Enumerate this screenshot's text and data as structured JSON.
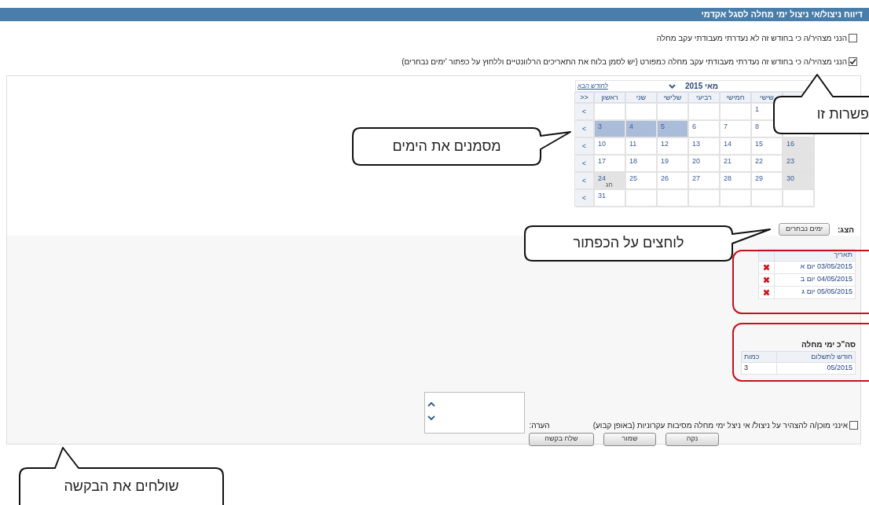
{
  "title": "דיווח ניצול/אי ניצול ימי מחלה לסגל אקדמי",
  "declarations": [
    {
      "label": "הנני מצהיר/ה כי בחודש זה לא נעדרתי מעבודתי עקב מחלה",
      "checked": false
    },
    {
      "label": "הנני מצהיר/ה כי בחודש זה נעדרתי מעבודתי עקב מחלה כמפורט (יש לסמן בלוח את התאריכים הרלוונטיים וללחוץ על כפתור 'ימים נבחרים)",
      "checked": true
    }
  ],
  "calendar": {
    "next_link": "לחודש הבא",
    "month": "מאי 2015",
    "week_header": ">>",
    "weekdays": [
      "שישי",
      "חמישי",
      "רביעי",
      "שלישי",
      "שני",
      "ראשון"
    ],
    "weeks": [
      {
        "arrow": ">",
        "days": [
          {
            "day": "1",
            "selected": false,
            "shaded": false
          }
        ]
      },
      {
        "arrow": ">",
        "days": [
          {
            "day": "8",
            "selected": false,
            "shaded": false
          },
          {
            "day": "7",
            "selected": false,
            "shaded": false
          },
          {
            "day": "6",
            "selected": false,
            "shaded": false
          },
          {
            "day": "5",
            "selected": true
          },
          {
            "day": "4",
            "selected": true
          },
          {
            "day": "3",
            "selected": true
          }
        ]
      },
      {
        "arrow": ">",
        "days": [
          {
            "day": "16",
            "selected": false,
            "shaded": true
          },
          {
            "day": "15",
            "selected": false,
            "shaded": false
          },
          {
            "day": "14",
            "selected": false,
            "shaded": false
          },
          {
            "day": "13",
            "selected": false,
            "shaded": false
          },
          {
            "day": "12",
            "selected": false,
            "shaded": false
          },
          {
            "day": "11",
            "selected": false,
            "shaded": false
          },
          {
            "day": "10",
            "selected": false,
            "shaded": false
          }
        ]
      },
      {
        "arrow": ">",
        "days": [
          {
            "day": "23",
            "selected": false,
            "shaded": true
          },
          {
            "day": "22",
            "selected": false,
            "shaded": false
          },
          {
            "day": "21",
            "selected": false,
            "shaded": false
          },
          {
            "day": "20",
            "selected": false,
            "shaded": false
          },
          {
            "day": "19",
            "selected": false,
            "shaded": false
          },
          {
            "day": "18",
            "selected": false,
            "shaded": false
          },
          {
            "day": "17",
            "selected": false,
            "shaded": false
          }
        ]
      },
      {
        "arrow": ">",
        "days": [
          {
            "day": "30",
            "selected": false,
            "shaded": true
          },
          {
            "day": "29",
            "selected": false,
            "shaded": false
          },
          {
            "day": "28",
            "selected": false,
            "shaded": false
          },
          {
            "day": "27",
            "selected": false,
            "shaded": false
          },
          {
            "day": "26",
            "selected": false,
            "shaded": false
          },
          {
            "day": "25",
            "selected": false,
            "shaded": false
          },
          {
            "day": "24",
            "selected": false,
            "shaded": true,
            "note": "חג"
          }
        ]
      },
      {
        "arrow": ">",
        "days": [
          {
            "day": "31",
            "selected": false,
            "shaded": false
          }
        ]
      }
    ]
  },
  "show": {
    "label": "הצג:",
    "button": "ימים נבחרים"
  },
  "selected_dates": {
    "header": "תאריך",
    "rows": [
      "03/05/2015 יום א",
      "04/05/2015 יום ב",
      "05/05/2015 יום ג"
    ]
  },
  "totals": {
    "title": "סה\"כ ימי מחלה",
    "columns": [
      "חודש לתשלום",
      "כמות"
    ],
    "rows": [
      [
        "05/2015",
        "3"
      ]
    ]
  },
  "permanent": {
    "label": "אינני מוכן/ה להצהיר על ניצול/ אי ניצל ימי מחלה מסיבות עקרוניות (באופן קבוע)",
    "checked": false
  },
  "note": {
    "label": "הערה:"
  },
  "buttons": [
    "נקה",
    "שמור",
    "שלח בקשה"
  ],
  "callouts": [
    {
      "text": "פשרות זו"
    },
    {
      "text": "מסמנים את הימים"
    },
    {
      "text": "לוחצים על הכפתור"
    },
    {
      "text": "שולחים את הבקשה"
    }
  ]
}
